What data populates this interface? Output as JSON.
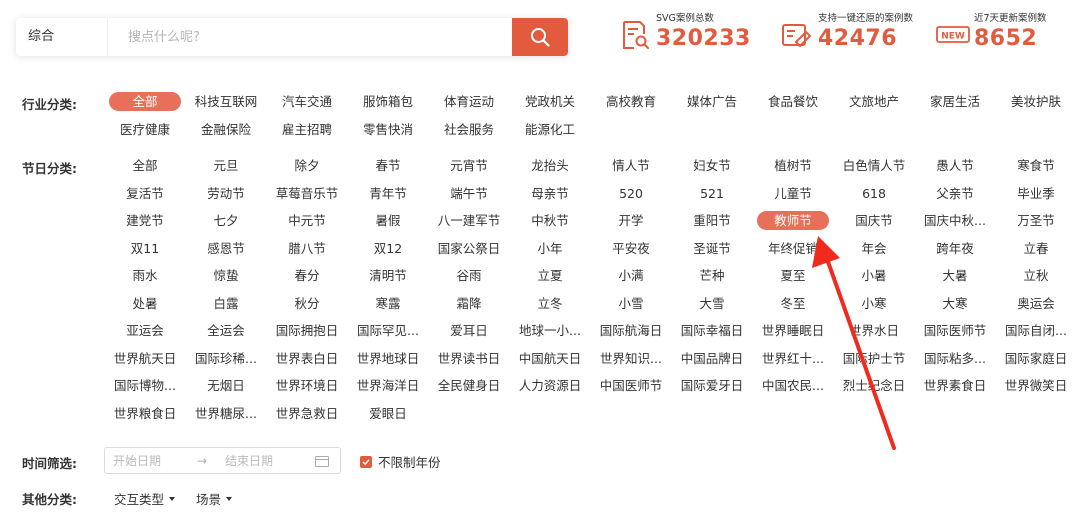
{
  "search": {
    "category": "综合",
    "placeholder": "搜点什么呢?"
  },
  "stats": [
    {
      "label": "SVG案例总数",
      "value": "320233",
      "icon": "document-search-icon"
    },
    {
      "label": "支持一键还原的案例数",
      "value": "42476",
      "icon": "restore-icon"
    },
    {
      "label": "近7天更新案例数",
      "value": "8652",
      "icon": "new-badge-icon",
      "badge": "NEW"
    }
  ],
  "industry": {
    "label": "行业分类:",
    "items": [
      "全部",
      "科技互联网",
      "汽车交通",
      "服饰箱包",
      "体育运动",
      "党政机关",
      "高校教育",
      "媒体广告",
      "食品餐饮",
      "文旅地产",
      "家居生活",
      "美妆护肤",
      "医疗健康",
      "金融保险",
      "雇主招聘",
      "零售快消",
      "社会服务",
      "能源化工"
    ],
    "active": "全部"
  },
  "festival": {
    "label": "节日分类:",
    "items": [
      "全部",
      "元旦",
      "除夕",
      "春节",
      "元宵节",
      "龙抬头",
      "情人节",
      "妇女节",
      "植树节",
      "白色情人节",
      "愚人节",
      "寒食节",
      "复活节",
      "劳动节",
      "草莓音乐节",
      "青年节",
      "端午节",
      "母亲节",
      "520",
      "521",
      "儿童节",
      "618",
      "父亲节",
      "毕业季",
      "建党节",
      "七夕",
      "中元节",
      "暑假",
      "八一建军节",
      "中秋节",
      "开学",
      "重阳节",
      "教师节",
      "国庆节",
      "国庆中秋...",
      "万圣节",
      "双11",
      "感恩节",
      "腊八节",
      "双12",
      "国家公祭日",
      "小年",
      "平安夜",
      "圣诞节",
      "年终促销",
      "年会",
      "跨年夜",
      "立春",
      "雨水",
      "惊蛰",
      "春分",
      "清明节",
      "谷雨",
      "立夏",
      "小满",
      "芒种",
      "夏至",
      "小暑",
      "大暑",
      "立秋",
      "处暑",
      "白露",
      "秋分",
      "寒露",
      "霜降",
      "立冬",
      "小雪",
      "大雪",
      "冬至",
      "小寒",
      "大寒",
      "奥运会",
      "亚运会",
      "全运会",
      "国际拥抱日",
      "国际罕见...",
      "爱耳日",
      "地球一小...",
      "国际航海日",
      "国际幸福日",
      "世界睡眠日",
      "世界水日",
      "国际医师节",
      "国际自闭...",
      "世界航天日",
      "国际珍稀...",
      "世界表白日",
      "世界地球日",
      "世界读书日",
      "中国航天日",
      "世界知识...",
      "中国品牌日",
      "世界红十...",
      "国际护士节",
      "国际粘多...",
      "国际家庭日",
      "国际博物...",
      "无烟日",
      "世界环境日",
      "世界海洋日",
      "全民健身日",
      "人力资源日",
      "中国医师节",
      "国际爱牙日",
      "中国农民...",
      "烈士纪念日",
      "世界素食日",
      "世界微笑日",
      "世界粮食日",
      "世界糖尿...",
      "世界急救日",
      "爱眼日"
    ],
    "active": "教师节"
  },
  "time": {
    "label": "时间筛选:",
    "start_placeholder": "开始日期",
    "arrow": "→",
    "end_placeholder": "结束日期",
    "unlimited": "不限制年份",
    "unlimited_checked": true
  },
  "other": {
    "label": "其他分类:",
    "dropdowns": [
      "交互类型",
      "场景"
    ]
  },
  "colors": {
    "accent": "#e35b3f",
    "active_tag": "#e8705a",
    "annotation_arrow": "#f02a1c"
  }
}
